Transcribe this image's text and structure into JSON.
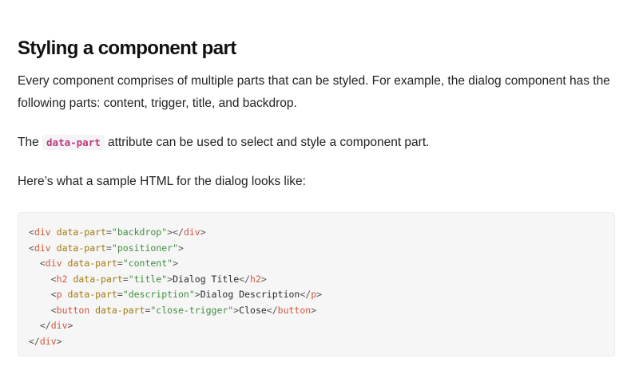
{
  "heading": "Styling a component part",
  "intro": "Every component comprises of multiple parts that can be styled. For example, the dialog component has the following parts: content, trigger, title, and backdrop.",
  "attr_sentence": {
    "before": "The ",
    "code": "data-part",
    "after": " attribute can be used to select and style a component part."
  },
  "sample_intro": "Here’s what a sample HTML for the dialog looks like:",
  "code_lines": [
    {
      "indent": "",
      "tag": "div",
      "attr": "data-part",
      "value": "\"backdrop\"",
      "inner": "",
      "close": "div"
    },
    {
      "indent": "",
      "tag": "div",
      "attr": "data-part",
      "value": "\"positioner\"",
      "inner": null,
      "close": null
    },
    {
      "indent": "  ",
      "tag": "div",
      "attr": "data-part",
      "value": "\"content\"",
      "inner": null,
      "close": null
    },
    {
      "indent": "    ",
      "tag": "h2",
      "attr": "data-part",
      "value": "\"title\"",
      "inner": "Dialog Title",
      "close": "h2"
    },
    {
      "indent": "    ",
      "tag": "p",
      "attr": "data-part",
      "value": "\"description\"",
      "inner": "Dialog Description",
      "close": "p"
    },
    {
      "indent": "    ",
      "tag": "button",
      "attr": "data-part",
      "value": "\"close-trigger\"",
      "inner": "Close",
      "close": "button"
    },
    {
      "indent": "  ",
      "closeonly": "div"
    },
    {
      "indent": "",
      "closeonly": "div"
    }
  ]
}
